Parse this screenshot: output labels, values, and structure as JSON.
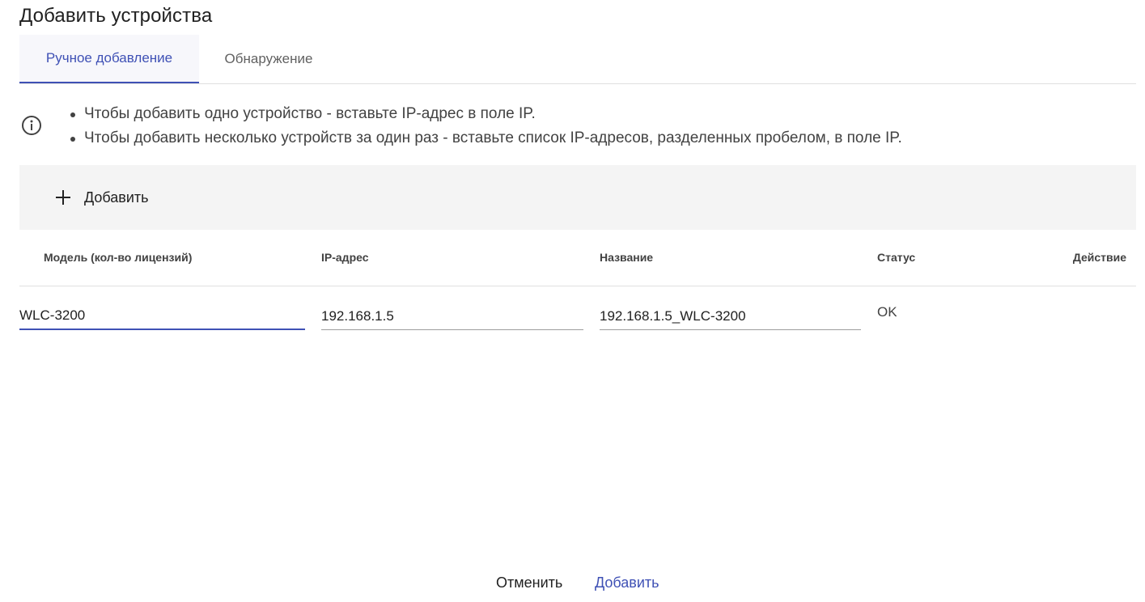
{
  "dialog": {
    "title": "Добавить устройства"
  },
  "tabs": [
    {
      "label": "Ручное добавление",
      "active": true
    },
    {
      "label": "Обнаружение",
      "active": false
    }
  ],
  "info": {
    "icon": "info-icon",
    "items": [
      "Чтобы добавить одно устройство - вставьте IP-адрес в поле IP.",
      "Чтобы добавить несколько устройств за один раз - вставьте список IP-адресов, разделенных пробелом, в поле IP."
    ]
  },
  "toolbar": {
    "add_icon": "plus-icon",
    "add_label": "Добавить"
  },
  "table": {
    "columns": [
      "Модель (кол-во лицензий)",
      "IP-адрес",
      "Название",
      "Статус",
      "Действие"
    ],
    "rows": [
      {
        "model": "WLC-3200",
        "ip": "192.168.1.5",
        "name": "192.168.1.5_WLC-3200",
        "status": "OK"
      }
    ]
  },
  "footer": {
    "cancel_label": "Отменить",
    "submit_label": "Добавить"
  },
  "colors": {
    "accent": "#3f51b5",
    "toolbar_bg": "#f4f4f4",
    "text": "#212121"
  }
}
